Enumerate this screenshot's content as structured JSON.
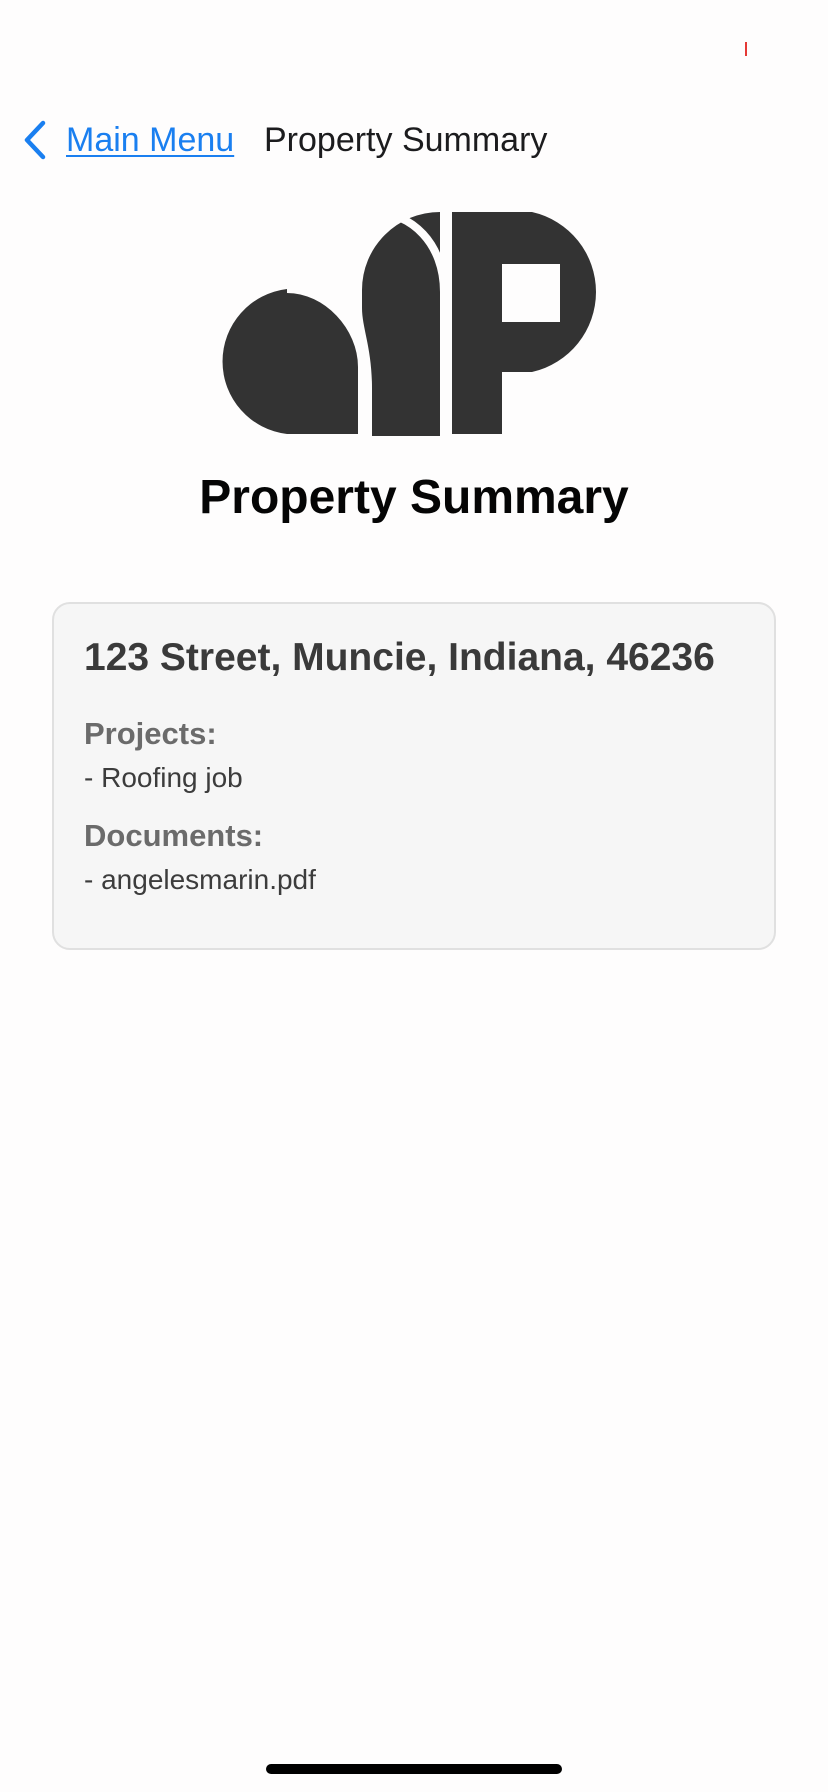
{
  "nav": {
    "back_label": "Main Menu",
    "title": "Property Summary",
    "back_icon": "chevron-left-icon"
  },
  "logo": {
    "icon": "company-logo",
    "color": "#333333"
  },
  "page": {
    "title": "Property Summary"
  },
  "property": {
    "address": "123 Street, Muncie, Indiana, 46236",
    "projects_heading": "Projects:",
    "projects": [
      "- Roofing job"
    ],
    "documents_heading": "Documents:",
    "documents": [
      "- angelesmarin.pdf"
    ]
  },
  "colors": {
    "accent": "#1a7ff0",
    "card_background": "#f6f6f6",
    "logo": "#333333"
  }
}
